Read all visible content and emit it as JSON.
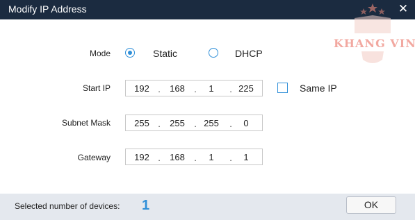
{
  "window": {
    "title": "Modify IP Address",
    "close_icon": "close-icon"
  },
  "form": {
    "mode_label": "Mode",
    "mode_options": [
      {
        "label": "Static",
        "selected": true
      },
      {
        "label": "DHCP",
        "selected": false
      }
    ],
    "start_ip_label": "Start IP",
    "start_ip": [
      "192",
      "168",
      "1",
      "225"
    ],
    "same_ip_label": "Same IP",
    "same_ip_checked": false,
    "subnet_label": "Subnet Mask",
    "subnet": [
      "255",
      "255",
      "255",
      "0"
    ],
    "gateway_label": "Gateway",
    "gateway": [
      "192",
      "168",
      "1",
      "1"
    ],
    "separator": "."
  },
  "footer": {
    "selected_label": "Selected number of devices:",
    "selected_count": "1",
    "ok_label": "OK"
  },
  "watermark": {
    "text": "KHANG VINH"
  },
  "colors": {
    "titlebar": "#1b2b40",
    "accent": "#2f8fd8",
    "footer": "#e4e8ee",
    "watermark": "#f2a8a0"
  }
}
